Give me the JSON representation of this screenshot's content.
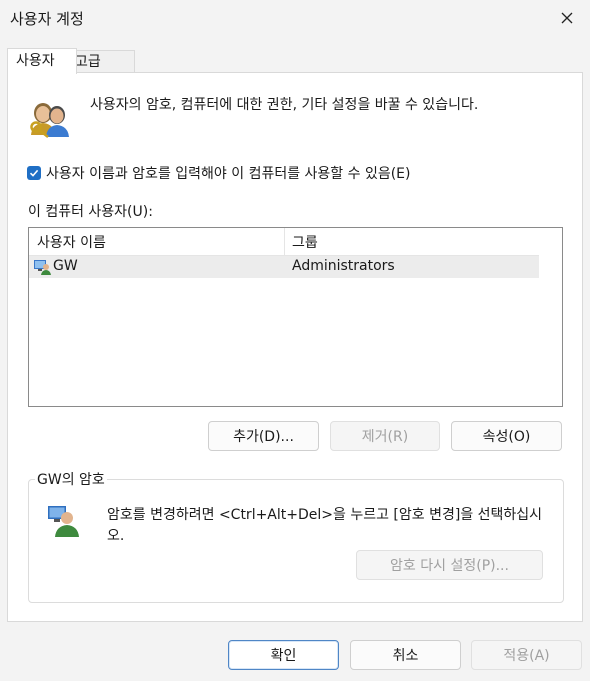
{
  "window": {
    "title": "사용자 계정"
  },
  "tabs": {
    "users": "사용자",
    "advanced": "고급"
  },
  "intro": {
    "text": "사용자의 암호, 컴퓨터에 대한 권한, 기타 설정을 바꿀 수 있습니다."
  },
  "require_login": {
    "checked": true,
    "label": "사용자 이름과 암호를 입력해야 이 컴퓨터를 사용할 수 있음(E)"
  },
  "users_list": {
    "label": "이 컴퓨터 사용자(U):",
    "columns": [
      "사용자 이름",
      "그룹"
    ],
    "rows": [
      {
        "name": "GW",
        "group": "Administrators"
      }
    ]
  },
  "user_buttons": {
    "add": "추가(D)...",
    "remove": "제거(R)",
    "properties": "속성(O)"
  },
  "password_group": {
    "title": "GW의 암호",
    "text": "암호를 변경하려면 <Ctrl+Alt+Del>을 누르고 [암호 변경]을 선택하십시오.",
    "reset_button": "암호 다시 설정(P)..."
  },
  "dialog_buttons": {
    "ok": "확인",
    "cancel": "취소",
    "apply": "적용(A)"
  },
  "colors": {
    "checkbox_accent": "#1f6fc5",
    "default_button_border": "#4f86c6"
  },
  "icons": {
    "close": "close-icon",
    "users": "users-keys-icon",
    "user_row": "user-icon",
    "password": "user-password-icon"
  }
}
